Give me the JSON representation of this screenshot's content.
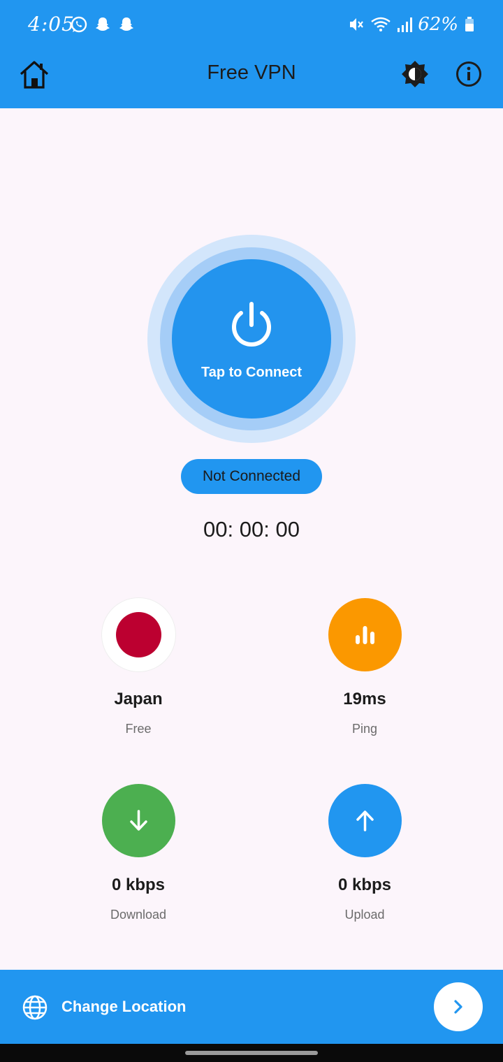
{
  "status_bar": {
    "time": "4:05",
    "battery": "62%",
    "icons": [
      "whatsapp-icon",
      "snapchat-icon",
      "snapchat-icon",
      "mute-icon",
      "wifi-icon",
      "signal-icon",
      "battery-icon"
    ]
  },
  "app_bar": {
    "title": "Free VPN",
    "icons": [
      "home-icon",
      "brightness-icon",
      "info-icon"
    ]
  },
  "connect": {
    "label": "Tap to Connect",
    "status": "Not Connected",
    "timer": "00: 00: 00"
  },
  "stats": {
    "country": {
      "value": "Japan",
      "label": "Free"
    },
    "ping": {
      "value": "19ms",
      "label": "Ping"
    },
    "download": {
      "value": "0 kbps",
      "label": "Download"
    },
    "upload": {
      "value": "0 kbps",
      "label": "Upload"
    }
  },
  "bottom_bar": {
    "label": "Change Location"
  },
  "colors": {
    "primary": "#2196f0",
    "background": "#fcf5fb",
    "ping": "#fb9800",
    "download": "#4caf50",
    "upload": "#2196f0",
    "flag_red": "#bc0030"
  }
}
